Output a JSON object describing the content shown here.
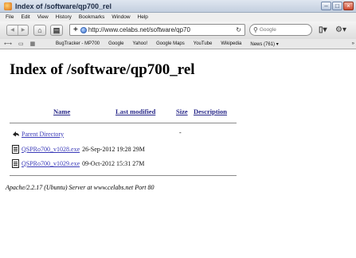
{
  "window": {
    "title": "Index of /software/qp700_rel"
  },
  "menu": {
    "items": [
      "File",
      "Edit",
      "View",
      "History",
      "Bookmarks",
      "Window",
      "Help"
    ]
  },
  "toolbar": {
    "back_icon": "back-arrow-icon",
    "forward_icon": "forward-arrow-icon",
    "url": "http://www.celabs.net/software/qp70",
    "search_placeholder": "Google"
  },
  "bookmarks": [
    "BugTracker - MP700",
    "Google",
    "Yahoo!",
    "Google Maps",
    "YouTube",
    "Wikipedia",
    "News (761) ▾"
  ],
  "page": {
    "heading": "Index of /software/qp700_rel",
    "columns": {
      "name": "Name",
      "modified": "Last modified",
      "size": "Size",
      "description": "Description"
    },
    "parent": {
      "label": "Parent Directory",
      "size": "-"
    },
    "files": [
      {
        "name": "QSPRo700_v1028.exe",
        "modified": "26-Sep-2012 19:28",
        "size": "29M"
      },
      {
        "name": "QSPRo700_v1029.exe",
        "modified": "09-Oct-2012 15:31",
        "size": "27M"
      }
    ],
    "footer": "Apache/2.2.17 (Ubuntu) Server at www.celabs.net Port 80"
  }
}
